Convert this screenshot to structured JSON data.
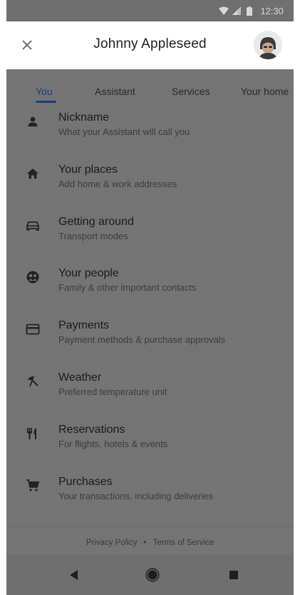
{
  "status_bar": {
    "time": "12:30",
    "icons": [
      "wifi-icon",
      "signal-icon",
      "battery-icon"
    ]
  },
  "header": {
    "title": "Johnny Appleseed",
    "close_icon": "close-icon",
    "avatar_icon": "avatar-icon"
  },
  "tabs": [
    {
      "label": "You",
      "active": true
    },
    {
      "label": "Assistant",
      "active": false
    },
    {
      "label": "Services",
      "active": false
    },
    {
      "label": "Your home",
      "active": false
    }
  ],
  "list": [
    {
      "icon": "person-icon",
      "title": "Nickname",
      "subtitle": "What your Assistant will call you"
    },
    {
      "icon": "home-icon",
      "title": "Your places",
      "subtitle": "Add home & work addresses"
    },
    {
      "icon": "car-icon",
      "title": "Getting around",
      "subtitle": "Transport modes"
    },
    {
      "icon": "people-icon",
      "title": "Your people",
      "subtitle": "Family & other important contacts"
    },
    {
      "icon": "credit-card-icon",
      "title": "Payments",
      "subtitle": "Payment methods & purchase approvals"
    },
    {
      "icon": "weather-icon",
      "title": "Weather",
      "subtitle": "Preferred temperature unit"
    },
    {
      "icon": "restaurant-icon",
      "title": "Reservations",
      "subtitle": "For flights, hotels & events"
    },
    {
      "icon": "cart-icon",
      "title": "Purchases",
      "subtitle": "Your transactions, including deliveries"
    }
  ],
  "footer": {
    "privacy": "Privacy Policy",
    "separator": "•",
    "terms": "Terms of Service"
  },
  "navbar": {
    "icons": [
      "back-icon",
      "home-button-icon",
      "recents-icon"
    ]
  },
  "colors": {
    "accent": "#1a3f7a",
    "overlay_bg": "#747474",
    "header_bg": "#ffffff"
  }
}
